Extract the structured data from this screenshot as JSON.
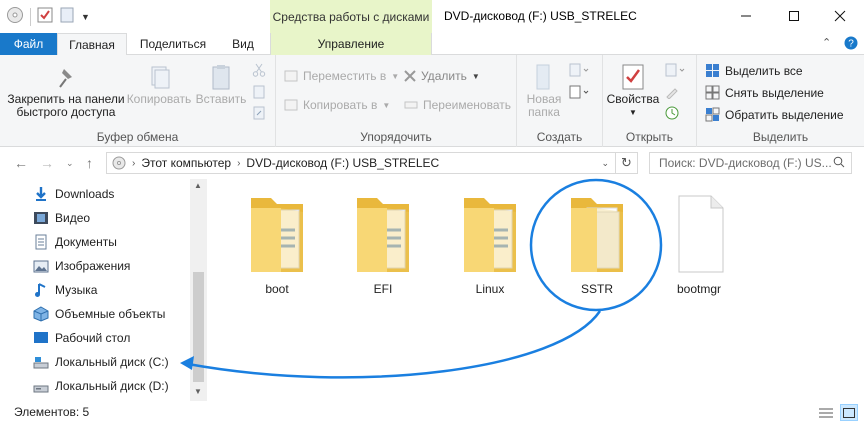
{
  "window": {
    "title": "DVD-дисковод (F:) USB_STRELEC",
    "contextual_tools": "Средства работы с дисками"
  },
  "tabs": [
    {
      "label": "Файл"
    },
    {
      "label": "Главная"
    },
    {
      "label": "Поделиться"
    },
    {
      "label": "Вид"
    },
    {
      "label": "Управление"
    }
  ],
  "ribbon": {
    "clipboard": {
      "label": "Буфер обмена",
      "pin_line1": "Закрепить на панели",
      "pin_line2": "быстрого доступа",
      "copy": "Копировать",
      "paste": "Вставить"
    },
    "organize": {
      "label": "Упорядочить",
      "move_to": "Переместить в",
      "copy_to": "Копировать в",
      "delete": "Удалить",
      "rename": "Переименовать"
    },
    "new": {
      "label": "Создать",
      "new_folder_line1": "Новая",
      "new_folder_line2": "папка"
    },
    "open": {
      "label": "Открыть",
      "properties": "Свойства"
    },
    "select": {
      "label": "Выделить",
      "select_all": "Выделить все",
      "select_none": "Снять выделение",
      "invert": "Обратить выделение"
    }
  },
  "address": {
    "crumbs": [
      "Этот компьютер",
      "DVD-дисковод (F:) USB_STRELEC"
    ],
    "search_placeholder": "Поиск: DVD-дисковод (F:) US..."
  },
  "nav_items": [
    {
      "label": "Downloads",
      "icon": "download-icon"
    },
    {
      "label": "Видео",
      "icon": "video-icon"
    },
    {
      "label": "Документы",
      "icon": "documents-icon"
    },
    {
      "label": "Изображения",
      "icon": "pictures-icon"
    },
    {
      "label": "Музыка",
      "icon": "music-icon"
    },
    {
      "label": "Объемные объекты",
      "icon": "3d-objects-icon"
    },
    {
      "label": "Рабочий стол",
      "icon": "desktop-icon"
    },
    {
      "label": "Локальный диск (C:)",
      "icon": "drive-c-icon"
    },
    {
      "label": "Локальный диск (D:)",
      "icon": "drive-d-icon"
    }
  ],
  "files": [
    {
      "name": "boot",
      "type": "folder"
    },
    {
      "name": "EFI",
      "type": "folder"
    },
    {
      "name": "Linux",
      "type": "folder"
    },
    {
      "name": "SSTR",
      "type": "folder"
    },
    {
      "name": "bootmgr",
      "type": "file"
    }
  ],
  "status": {
    "items_count": "Элементов: 5"
  },
  "colors": {
    "accent": "#1979ca",
    "tools_header": "#e8f5c9",
    "folder": "#f8d775",
    "annotation": "#1a7fe0"
  }
}
